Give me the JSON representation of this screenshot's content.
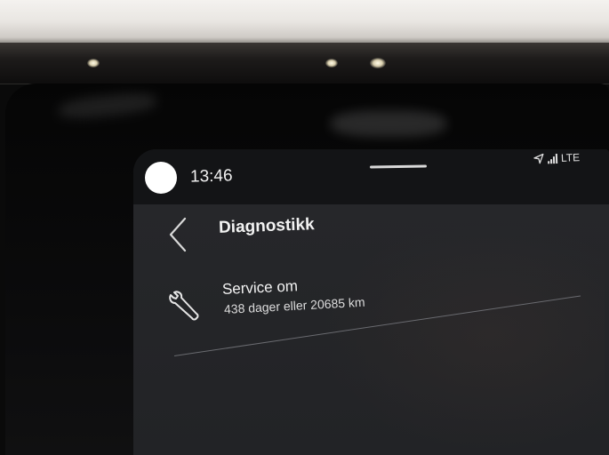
{
  "status_bar": {
    "time": "13:46",
    "network_label": "LTE",
    "icons": [
      "avatar-icon",
      "location-arrow-icon",
      "signal-icon"
    ]
  },
  "header": {
    "title": "Diagnostikk",
    "back_icon": "chevron-left-icon"
  },
  "service": {
    "icon": "wrench-icon",
    "title": "Service om",
    "detail": "438 dager eller 20685 km"
  }
}
